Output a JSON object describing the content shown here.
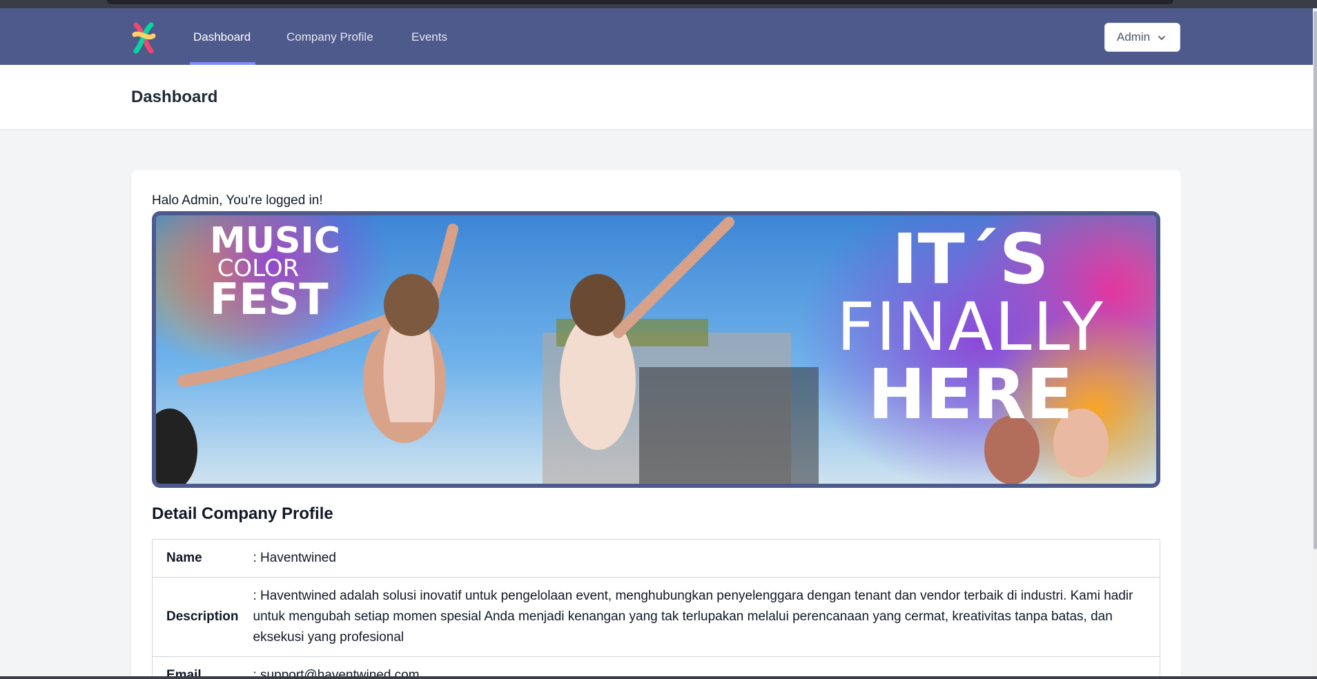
{
  "nav": {
    "links": [
      {
        "label": "Dashboard",
        "active": true
      },
      {
        "label": "Company Profile",
        "active": false
      },
      {
        "label": "Events",
        "active": false
      }
    ],
    "user_menu_label": "Admin"
  },
  "header": {
    "title": "Dashboard"
  },
  "main": {
    "greeting": "Halo Admin, You're logged in!",
    "banner": {
      "left_text": [
        "MUSIC",
        "COLOR",
        "FEST"
      ],
      "right_text": [
        "IT´S",
        "FINALLY",
        "HERE"
      ]
    },
    "section_title": "Detail Company Profile",
    "profile_rows": [
      {
        "label": "Name",
        "value": ": Haventwined"
      },
      {
        "label": "Description",
        "value": ": Haventwined adalah solusi inovatif untuk pengelolaan event, menghubungkan penyelenggara dengan tenant dan vendor terbaik di industri. Kami hadir untuk mengubah setiap momen spesial Anda menjadi kenangan yang tak terlupakan melalui perencanaan yang cermat, kreativitas tanpa batas, dan eksekusi yang profesional"
      },
      {
        "label": "Email",
        "value": ": support@haventwined.com"
      }
    ]
  },
  "colors": {
    "navbar": "#4f5a8c",
    "accent_underline": "#818cf8",
    "page_bg": "#f3f4f6"
  }
}
